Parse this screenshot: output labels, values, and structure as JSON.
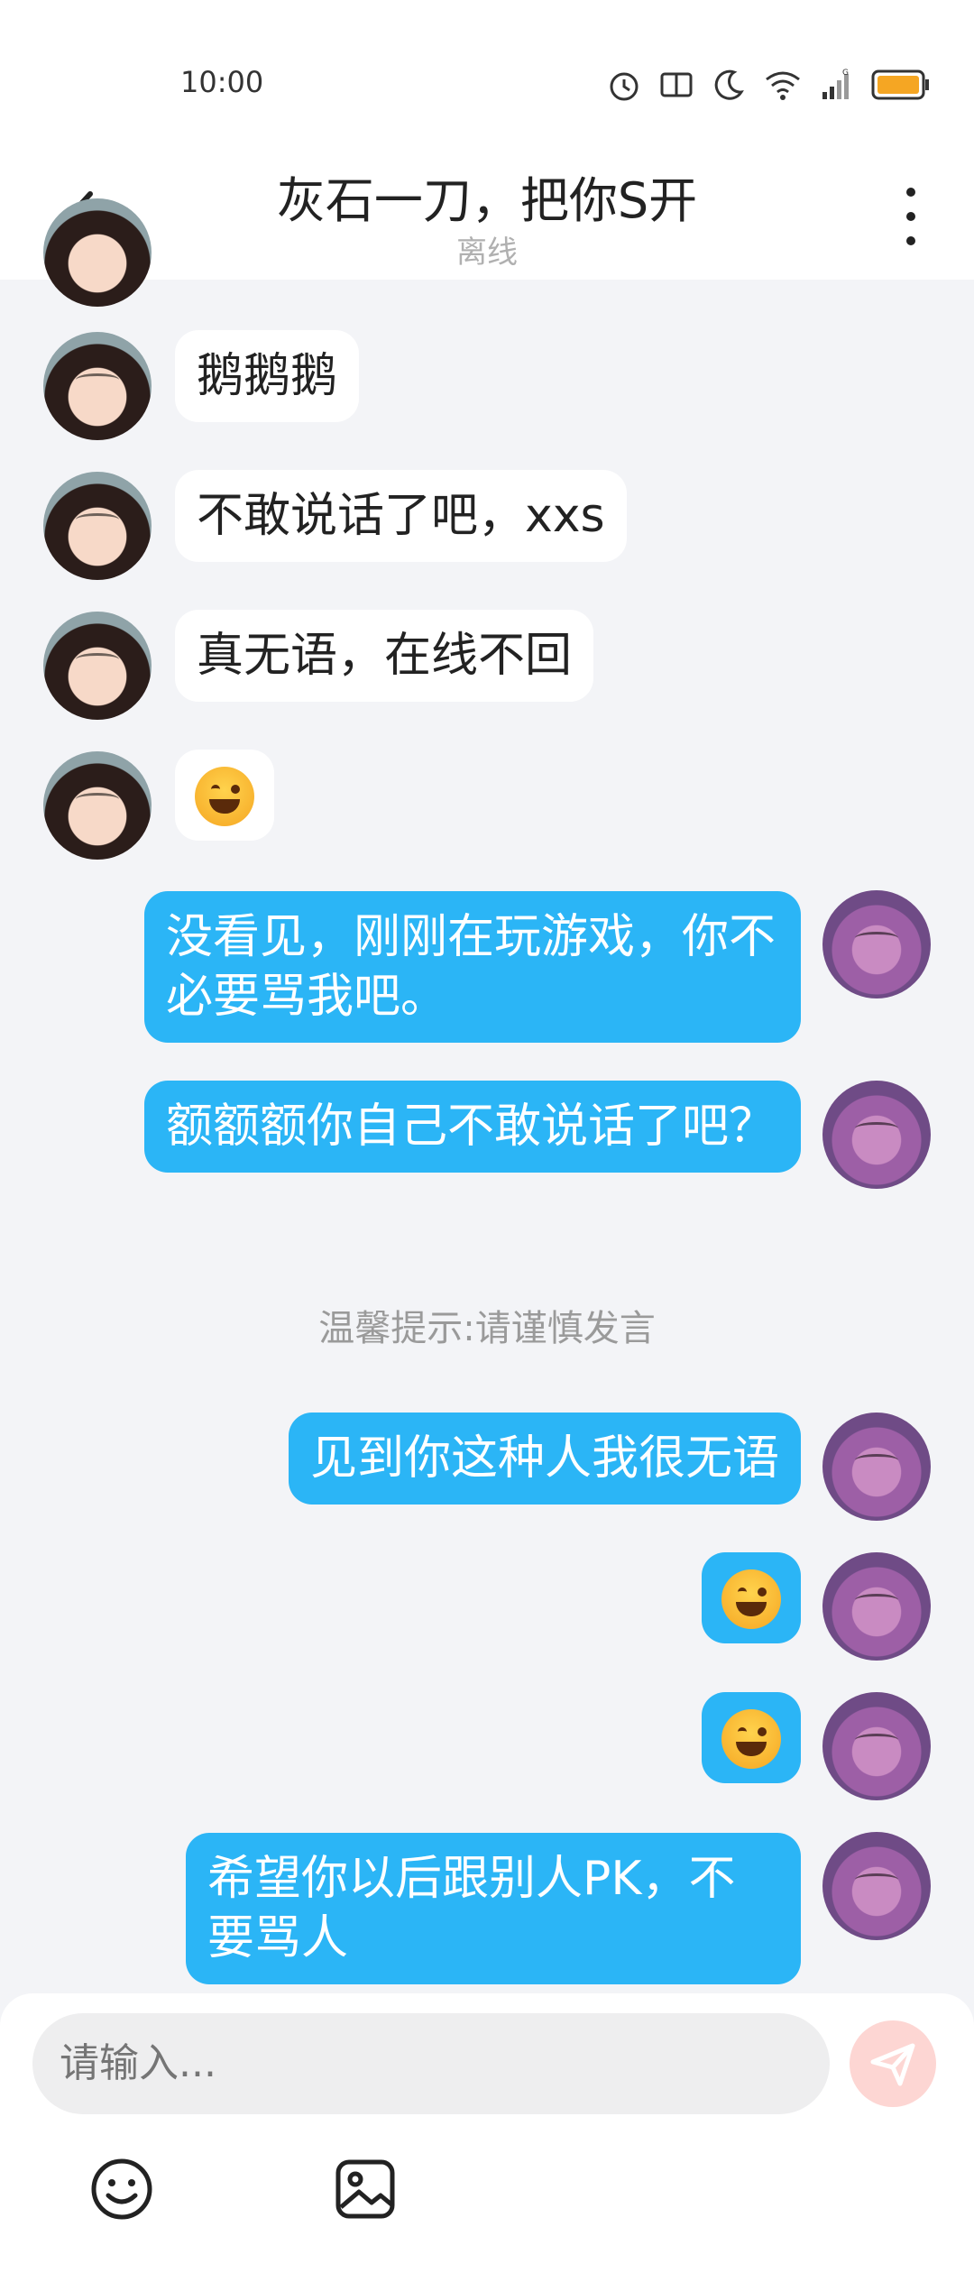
{
  "status_bar": {
    "time": "10:00",
    "network_label": "G"
  },
  "header": {
    "title": "灰石一刀，把你S开",
    "subtitle": "离线"
  },
  "messages": [
    {
      "side": "left",
      "text": "鹅鹅鹅"
    },
    {
      "side": "left",
      "text": "不敢说话了吧，xxs"
    },
    {
      "side": "left",
      "text": "真无语，在线不回"
    },
    {
      "side": "left",
      "emoji": "sweat-smile-emoji"
    },
    {
      "side": "right",
      "text": "没看见，刚刚在玩游戏，你不必要骂我吧。"
    },
    {
      "side": "right",
      "text": "额额额你自己不敢说话了吧？"
    },
    {
      "side": "right",
      "text": "见到你这种人我很无语"
    },
    {
      "side": "right",
      "emoji": "angry-steam-emoji"
    },
    {
      "side": "right",
      "emoji": "sweat-smile-emoji"
    },
    {
      "side": "right",
      "text": "希望你以后跟别人PK，不要骂人"
    }
  ],
  "system_tip": "温馨提示:请谨慎发言",
  "input": {
    "placeholder": "请输入..."
  },
  "colors": {
    "bubble_right": "#2bb5f6",
    "bubble_left": "#ffffff",
    "background": "#f3f4f7",
    "send_button": "#fdd6d3"
  }
}
